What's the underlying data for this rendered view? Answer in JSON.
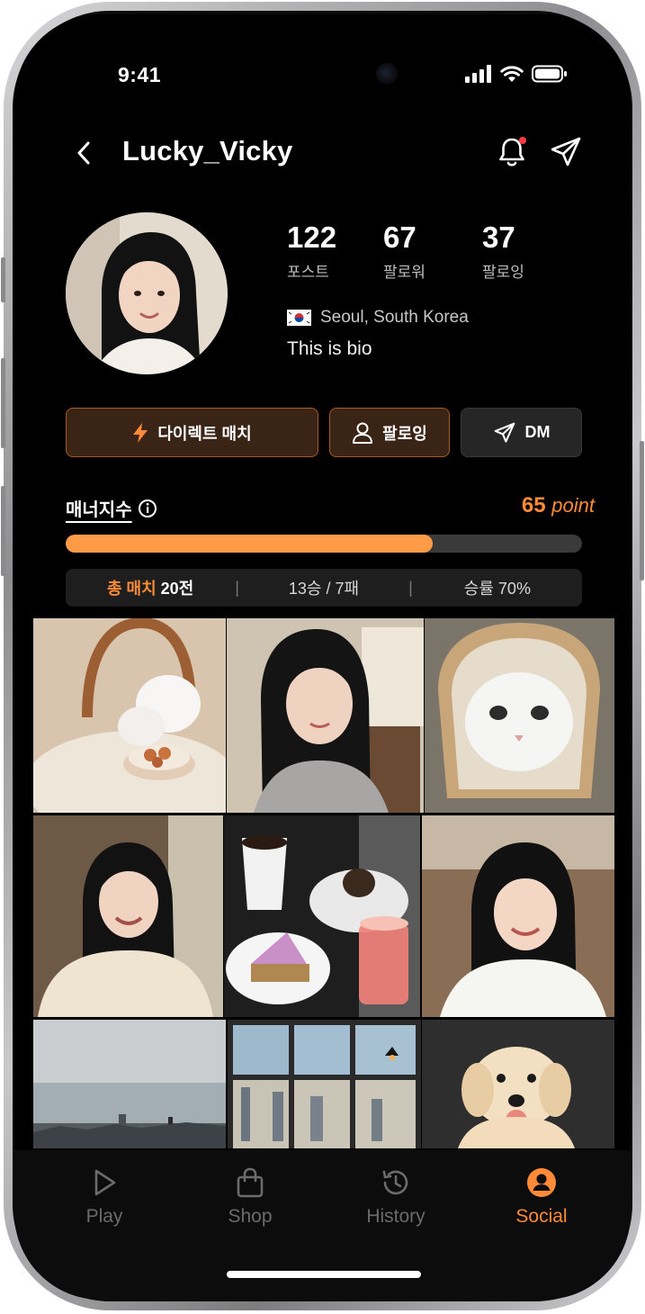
{
  "status_bar": {
    "time": "9:41"
  },
  "header": {
    "username": "Lucky_Vicky"
  },
  "stats": [
    {
      "value": "122",
      "label": "포스트"
    },
    {
      "value": "67",
      "label": "팔로워"
    },
    {
      "value": "37",
      "label": "팔로잉"
    }
  ],
  "profile": {
    "location": "Seoul, South Korea",
    "bio": "This is bio"
  },
  "actions": {
    "direct_match": "다이렉트 매치",
    "following": "팔로잉",
    "dm": "DM"
  },
  "manner": {
    "label": "매너지수",
    "point_value": "65",
    "point_unit": "point",
    "progress_fraction": 0.71
  },
  "match_summary": {
    "total_lead": "총 매치",
    "total_count": "20전",
    "record": "13승 / 7패",
    "win_rate": "승률 70%"
  },
  "tabs": [
    {
      "label": "Play",
      "icon": "play-icon",
      "active": false
    },
    {
      "label": "Shop",
      "icon": "bag-icon",
      "active": false
    },
    {
      "label": "History",
      "icon": "clock-icon",
      "active": false
    },
    {
      "label": "Social",
      "icon": "person-circle-icon",
      "active": true
    }
  ],
  "colors": {
    "accent": "#ff8a38",
    "progress": "#ff9a47",
    "button_fill": "#3a2415",
    "button_border": "#a65a24",
    "inactive_tab": "#6b6b6b"
  }
}
